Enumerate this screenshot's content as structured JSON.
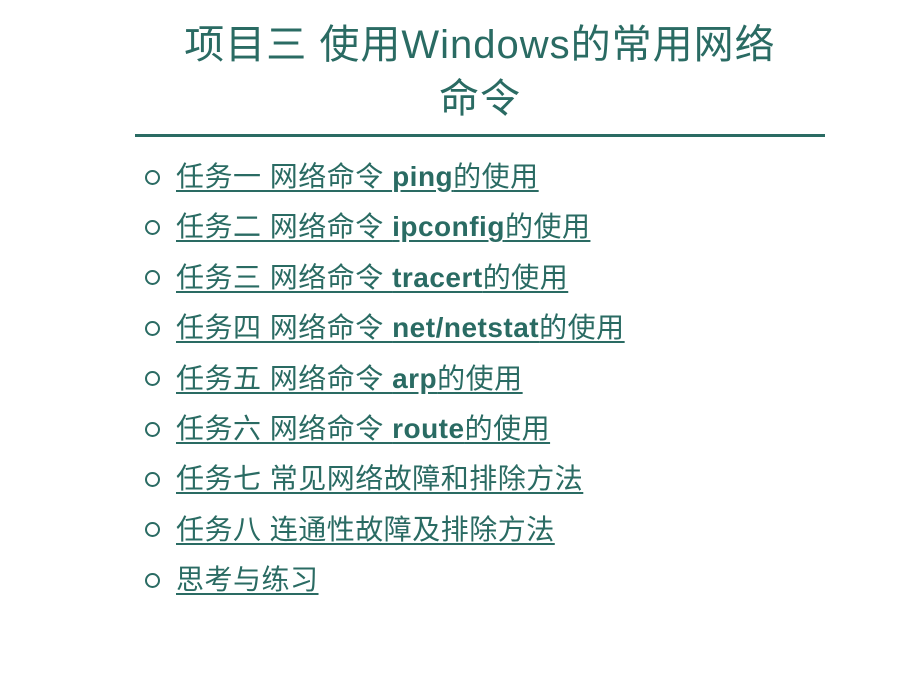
{
  "title": "项目三   使用Windows的常用网络命令",
  "items": [
    {
      "prefix": "任务一   网络命令 ",
      "bold": "ping",
      "suffix": "的使用"
    },
    {
      "prefix": "任务二   网络命令 ",
      "bold": "ipconfig",
      "suffix": "的使用"
    },
    {
      "prefix": "任务三   网络命令 ",
      "bold": "tracert",
      "suffix": "的使用"
    },
    {
      "prefix": "任务四   网络命令 ",
      "bold": "net/netstat",
      "suffix": "的使用"
    },
    {
      "prefix": "任务五   网络命令 ",
      "bold": "arp",
      "suffix": "的使用"
    },
    {
      "prefix": "任务六   网络命令 ",
      "bold": "route",
      "suffix": "的使用"
    },
    {
      "prefix": "任务七   常见网络故障和排除方法",
      "bold": "",
      "suffix": ""
    },
    {
      "prefix": "任务八   连通性故障及排除方法",
      "bold": "",
      "suffix": ""
    },
    {
      "prefix": "思考与练习",
      "bold": "",
      "suffix": ""
    }
  ]
}
